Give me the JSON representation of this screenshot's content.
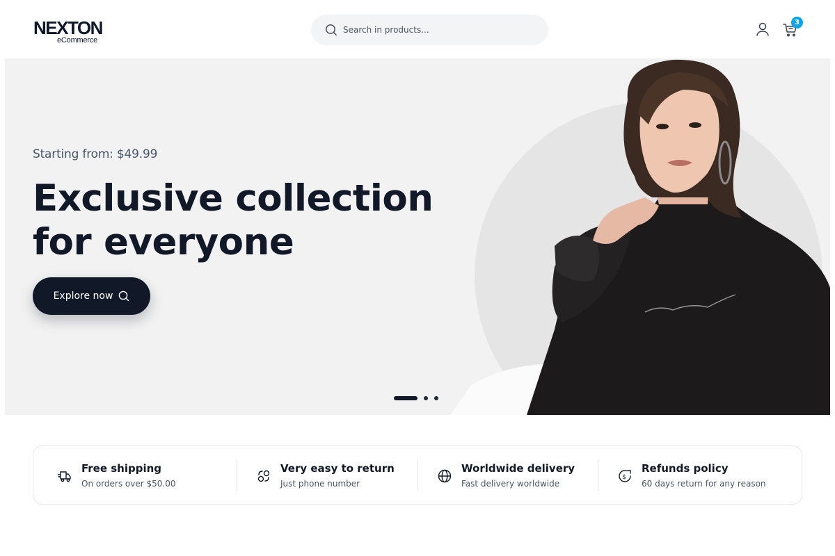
{
  "header": {
    "logo_main": "NEXTON",
    "logo_sub": "eCommerce",
    "search": {
      "placeholder": "Search in products..."
    },
    "cart_count": "3",
    "icons": {
      "search": "search-icon",
      "user": "user-icon",
      "cart": "cart-icon"
    }
  },
  "hero": {
    "price_text": "Starting from: $49.99",
    "title_line1": "Exclusive collection",
    "title_line2": "for everyone",
    "cta_label": "Explore now",
    "slides": {
      "count": 3,
      "active": 1
    }
  },
  "features": [
    {
      "icon": "truck-icon",
      "title": "Free shipping",
      "subtitle": "On orders over $50.00"
    },
    {
      "icon": "return-icon",
      "title": "Very easy to return",
      "subtitle": "Just phone number"
    },
    {
      "icon": "globe-icon",
      "title": "Worldwide delivery",
      "subtitle": "Fast delivery worldwide"
    },
    {
      "icon": "refund-icon",
      "title": "Refunds policy",
      "subtitle": "60 days return for any reason"
    }
  ],
  "colors": {
    "primary": "#111827",
    "badge": "#0ea5e9",
    "hero_bg": "#f2f2f2",
    "search_bg": "#f3f4f6"
  }
}
